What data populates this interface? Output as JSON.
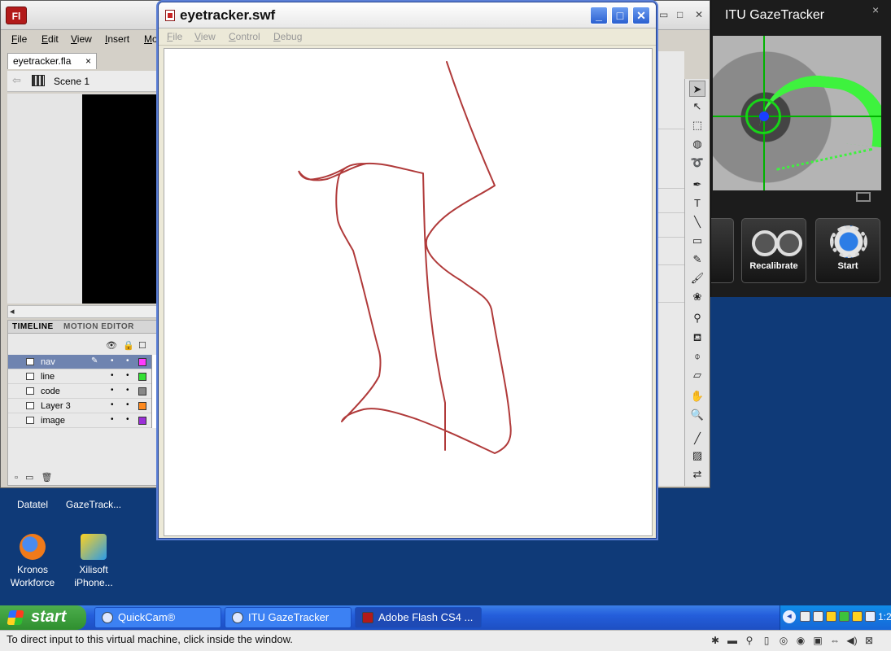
{
  "flash": {
    "logo": "Fl",
    "menu": [
      "File",
      "Edit",
      "View",
      "Insert",
      "Mod"
    ],
    "doc_tab": "eyetracker.fla",
    "doc_tab_close": "×",
    "scene": "Scene 1",
    "timeline_tabs": [
      "TIMELINE",
      "MOTION EDITOR"
    ],
    "layers": [
      {
        "name": "nav",
        "color": "#ff3bff",
        "selected": true
      },
      {
        "name": "line",
        "color": "#33e033"
      },
      {
        "name": "code",
        "color": "#888888"
      },
      {
        "name": "Layer 3",
        "color": "#ff8a1f"
      },
      {
        "name": "image",
        "color": "#9b2fd8"
      }
    ]
  },
  "swf": {
    "title": "eyetracker.swf",
    "menu": [
      "File",
      "View",
      "Control",
      "Debug"
    ],
    "stroke_color": "#b03a3a",
    "minimize": "_",
    "maximize": "□",
    "close": "✕"
  },
  "gaze": {
    "title": "ITU GazeTracker",
    "close": "×",
    "buttons": [
      {
        "label": "Recalibrate"
      },
      {
        "label": "Start"
      }
    ]
  },
  "desktop_icons": [
    {
      "line1": "Datatel",
      "line2": ""
    },
    {
      "line1": "GazeTrack...",
      "line2": ""
    },
    {
      "line1": "Kronos",
      "line2": "Workforce"
    },
    {
      "line1": "Xilisoft",
      "line2": "iPhone..."
    }
  ],
  "taskbar": {
    "start": "start",
    "tasks": [
      {
        "label": "QuickCam®"
      },
      {
        "label": "ITU GazeTracker"
      },
      {
        "label": "Adobe Flash CS4 ..."
      }
    ],
    "clock": "1:2"
  },
  "vm_status": "To direct input to this virtual machine, click inside the window."
}
